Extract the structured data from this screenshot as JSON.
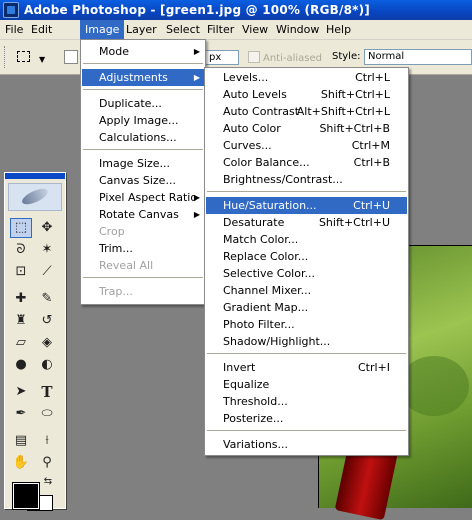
{
  "window": {
    "title": "Adobe Photoshop - [green1.jpg @ 100% (RGB/8*)]"
  },
  "menubar": [
    "File",
    "Edit",
    "Image",
    "Layer",
    "Select",
    "Filter",
    "View",
    "Window",
    "Help"
  ],
  "menubar_active": "Image",
  "options": {
    "units_value": "px",
    "antialias_label": "Anti-aliased",
    "style_label": "Style:",
    "style_value": "Normal"
  },
  "image_menu": {
    "mode": "Mode",
    "adjustments": "Adjustments",
    "duplicate": "Duplicate...",
    "apply_image": "Apply Image...",
    "calculations": "Calculations...",
    "image_size": "Image Size...",
    "canvas_size": "Canvas Size...",
    "pixel_aspect_ratio": "Pixel Aspect Ratio",
    "rotate_canvas": "Rotate Canvas",
    "crop": "Crop",
    "trim": "Trim...",
    "reveal_all": "Reveal All",
    "trap": "Trap..."
  },
  "adjustments_menu": {
    "levels": {
      "label": "Levels...",
      "shortcut": "Ctrl+L"
    },
    "auto_levels": {
      "label": "Auto Levels",
      "shortcut": "Shift+Ctrl+L"
    },
    "auto_contrast": {
      "label": "Auto Contrast",
      "shortcut": "Alt+Shift+Ctrl+L"
    },
    "auto_color": {
      "label": "Auto Color",
      "shortcut": "Shift+Ctrl+B"
    },
    "curves": {
      "label": "Curves...",
      "shortcut": "Ctrl+M"
    },
    "color_balance": {
      "label": "Color Balance...",
      "shortcut": "Ctrl+B"
    },
    "brightness_contrast": {
      "label": "Brightness/Contrast..."
    },
    "hue_saturation": {
      "label": "Hue/Saturation...",
      "shortcut": "Ctrl+U"
    },
    "desaturate": {
      "label": "Desaturate",
      "shortcut": "Shift+Ctrl+U"
    },
    "match_color": {
      "label": "Match Color..."
    },
    "replace_color": {
      "label": "Replace Color..."
    },
    "selective_color": {
      "label": "Selective Color..."
    },
    "channel_mixer": {
      "label": "Channel Mixer..."
    },
    "gradient_map": {
      "label": "Gradient Map..."
    },
    "photo_filter": {
      "label": "Photo Filter..."
    },
    "shadow_highlight": {
      "label": "Shadow/Highlight..."
    },
    "invert": {
      "label": "Invert",
      "shortcut": "Ctrl+I"
    },
    "equalize": {
      "label": "Equalize"
    },
    "threshold": {
      "label": "Threshold..."
    },
    "posterize": {
      "label": "Posterize..."
    },
    "variations": {
      "label": "Variations..."
    }
  },
  "toolbox": {
    "text_tool_glyph": "T",
    "tools": [
      "rectangular-marquee-icon",
      "move-icon",
      "lasso-icon",
      "magic-wand-icon",
      "crop-icon",
      "eyedropper-slice-icon",
      "healing-brush-icon",
      "brush-icon",
      "clone-stamp-icon",
      "history-brush-icon",
      "eraser-icon",
      "paint-bucket-icon",
      "blur-icon",
      "dodge-icon",
      "path-selection-icon",
      "type-icon",
      "pen-icon",
      "ellipse-icon",
      "notes-icon",
      "eyedropper-icon",
      "hand-icon",
      "zoom-icon"
    ]
  },
  "colors": {
    "accent": "#316ac5",
    "titlebar": "#0845c0",
    "menu_bg": "#ffffff",
    "chrome": "#ece9d8",
    "foreground": "#000000",
    "background": "#ffffff"
  }
}
